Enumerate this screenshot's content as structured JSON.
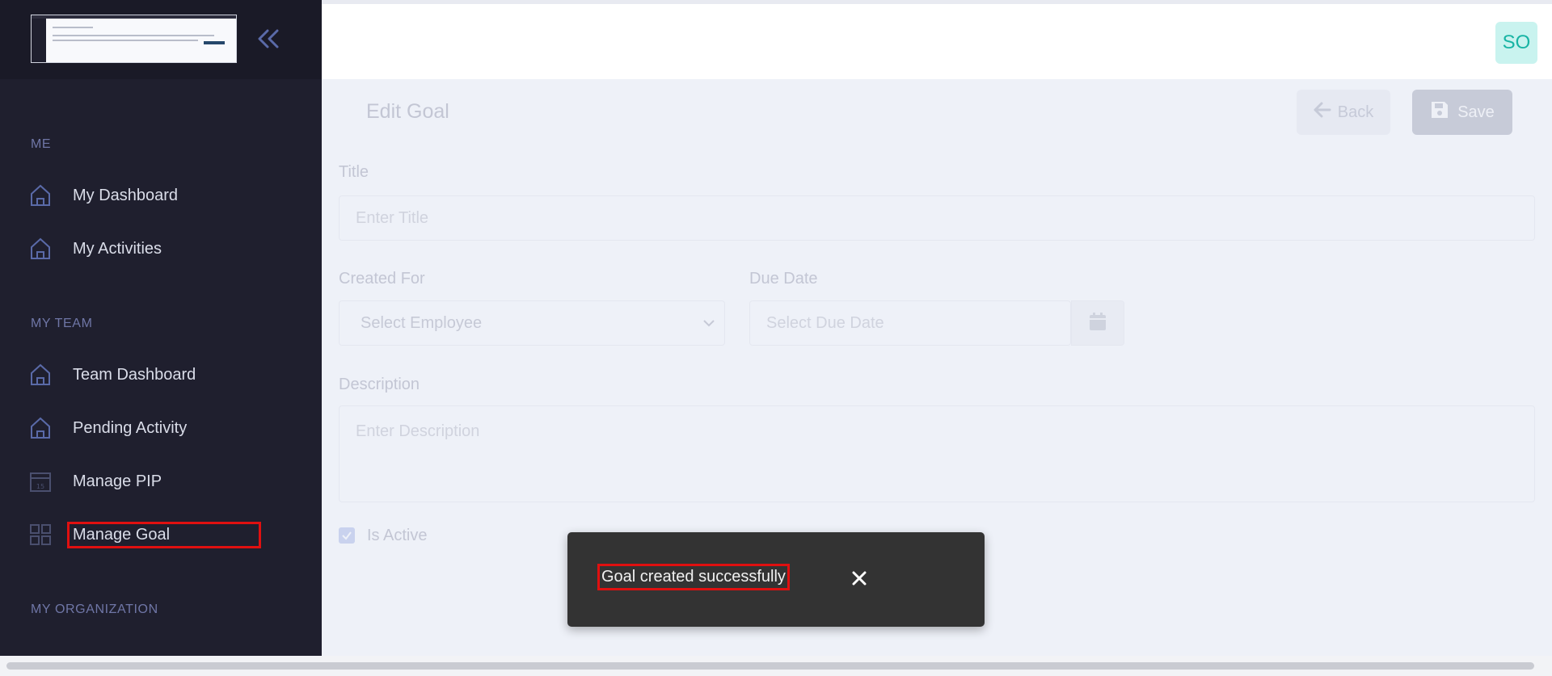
{
  "sidebar": {
    "sections": {
      "me": "ME",
      "my_team": "MY TEAM",
      "my_organization": "MY ORGANIZATION"
    },
    "items": [
      {
        "label": "My Dashboard",
        "icon": "home-icon"
      },
      {
        "label": "My Activities",
        "icon": "home-icon"
      },
      {
        "label": "Team Dashboard",
        "icon": "home-icon"
      },
      {
        "label": "Pending Activity",
        "icon": "home-icon"
      },
      {
        "label": "Manage PIP",
        "icon": "calendar-icon"
      },
      {
        "label": "Manage Goal",
        "icon": "grid-icon"
      }
    ],
    "collapse_icon": "double-chevron-left-icon"
  },
  "header": {
    "avatar_initials": "SO"
  },
  "page": {
    "title": "Edit Goal",
    "back_label": "Back",
    "save_label": "Save",
    "title_label": "Title",
    "title_placeholder": "Enter Title",
    "created_for_label": "Created For",
    "created_for_value": "Select Employee",
    "due_date_label": "Due Date",
    "due_date_placeholder": "Select Due Date",
    "description_label": "Description",
    "description_placeholder": "Enter Description",
    "is_active_label": "Is Active"
  },
  "toast": {
    "message": "Goal created successfully",
    "close_icon": "close-icon"
  },
  "colors": {
    "sidebar_bg": "#1f1f2e",
    "accent_teal": "#18b4a4",
    "highlight_red": "#e01010",
    "toast_bg": "#333333"
  }
}
